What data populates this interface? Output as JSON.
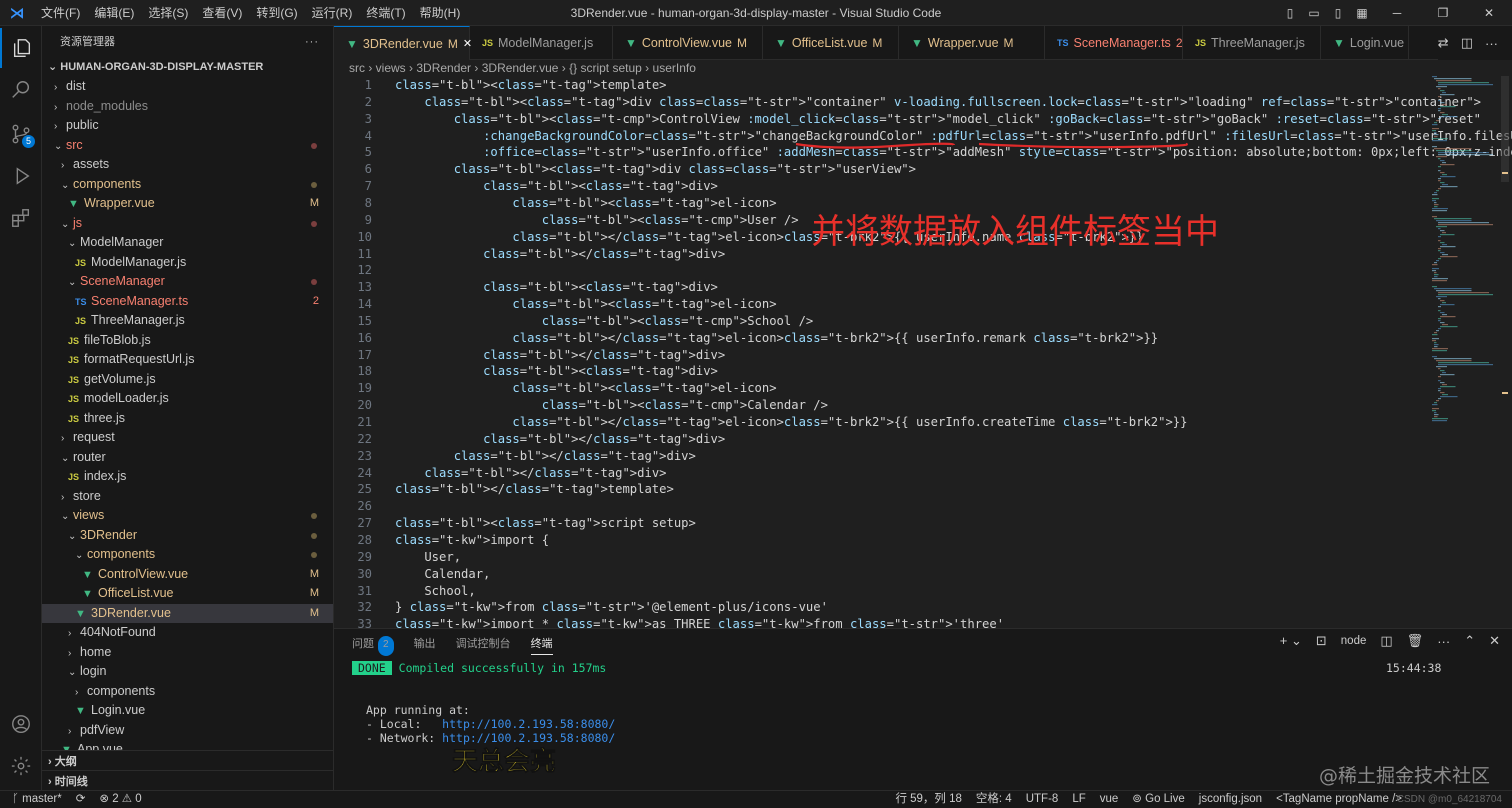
{
  "window": {
    "title": "3DRender.vue - human-organ-3d-display-master - Visual Studio Code",
    "menu": [
      "文件(F)",
      "编辑(E)",
      "选择(S)",
      "查看(V)",
      "转到(G)",
      "运行(R)",
      "终端(T)",
      "帮助(H)"
    ]
  },
  "sidebar": {
    "header": "资源管理器",
    "root": "HUMAN-ORGAN-3D-DISPLAY-MASTER",
    "tree": [
      {
        "label": "dist",
        "depth": 0,
        "folder": true,
        "open": false
      },
      {
        "label": "node_modules",
        "depth": 0,
        "folder": true,
        "open": false,
        "dim": true
      },
      {
        "label": "public",
        "depth": 0,
        "folder": true,
        "open": false
      },
      {
        "label": "src",
        "depth": 0,
        "folder": true,
        "open": true,
        "color": "err",
        "dot": "red"
      },
      {
        "label": "assets",
        "depth": 1,
        "folder": true,
        "open": false
      },
      {
        "label": "components",
        "depth": 1,
        "folder": true,
        "open": true,
        "color": "mod",
        "dot": "mod"
      },
      {
        "label": "Wrapper.vue",
        "depth": 2,
        "type": "vue",
        "color": "mod",
        "mark": "M"
      },
      {
        "label": "js",
        "depth": 1,
        "folder": true,
        "open": true,
        "color": "err",
        "dot": "red"
      },
      {
        "label": "ModelManager",
        "depth": 2,
        "folder": true,
        "open": true
      },
      {
        "label": "ModelManager.js",
        "depth": 3,
        "type": "js"
      },
      {
        "label": "SceneManager",
        "depth": 2,
        "folder": true,
        "open": true,
        "color": "err",
        "dot": "red"
      },
      {
        "label": "SceneManager.ts",
        "depth": 3,
        "type": "ts",
        "color": "err",
        "mark": "2"
      },
      {
        "label": "ThreeManager.js",
        "depth": 3,
        "type": "js"
      },
      {
        "label": "fileToBlob.js",
        "depth": 2,
        "type": "js"
      },
      {
        "label": "formatRequestUrl.js",
        "depth": 2,
        "type": "js"
      },
      {
        "label": "getVolume.js",
        "depth": 2,
        "type": "js"
      },
      {
        "label": "modelLoader.js",
        "depth": 2,
        "type": "js"
      },
      {
        "label": "three.js",
        "depth": 2,
        "type": "js"
      },
      {
        "label": "request",
        "depth": 1,
        "folder": true,
        "open": false
      },
      {
        "label": "router",
        "depth": 1,
        "folder": true,
        "open": true
      },
      {
        "label": "index.js",
        "depth": 2,
        "type": "js"
      },
      {
        "label": "store",
        "depth": 1,
        "folder": true,
        "open": false
      },
      {
        "label": "views",
        "depth": 1,
        "folder": true,
        "open": true,
        "color": "mod",
        "dot": "mod"
      },
      {
        "label": "3DRender",
        "depth": 2,
        "folder": true,
        "open": true,
        "color": "mod",
        "dot": "mod"
      },
      {
        "label": "components",
        "depth": 3,
        "folder": true,
        "open": true,
        "color": "mod",
        "dot": "mod"
      },
      {
        "label": "ControlView.vue",
        "depth": 4,
        "type": "vue",
        "color": "mod",
        "mark": "M"
      },
      {
        "label": "OfficeList.vue",
        "depth": 4,
        "type": "vue",
        "color": "mod",
        "mark": "M"
      },
      {
        "label": "3DRender.vue",
        "depth": 3,
        "type": "vue",
        "color": "mod",
        "mark": "M",
        "selected": true
      },
      {
        "label": "404NotFound",
        "depth": 2,
        "folder": true,
        "open": false
      },
      {
        "label": "home",
        "depth": 2,
        "folder": true,
        "open": false
      },
      {
        "label": "login",
        "depth": 2,
        "folder": true,
        "open": true
      },
      {
        "label": "components",
        "depth": 3,
        "folder": true,
        "open": false
      },
      {
        "label": "Login.vue",
        "depth": 3,
        "type": "vue"
      },
      {
        "label": "pdfView",
        "depth": 2,
        "folder": true,
        "open": false
      },
      {
        "label": "App.vue",
        "depth": 1,
        "type": "vue"
      }
    ],
    "sections": [
      "大纲",
      "时间线"
    ]
  },
  "tabs": [
    {
      "label": "3DRender.vue",
      "status": "M",
      "type": "vue",
      "active": true,
      "closable": true
    },
    {
      "label": "ModelManager.js",
      "status": "",
      "type": "js"
    },
    {
      "label": "ControlView.vue",
      "status": "M",
      "type": "vue"
    },
    {
      "label": "OfficeList.vue",
      "status": "M",
      "type": "vue"
    },
    {
      "label": "Wrapper.vue",
      "status": "M",
      "type": "vue"
    },
    {
      "label": "SceneManager.ts",
      "status": "2",
      "type": "ts"
    },
    {
      "label": "ThreeManager.js",
      "status": "",
      "type": "js"
    },
    {
      "label": "Login.vue",
      "status": "",
      "type": "vue"
    }
  ],
  "breadcrumb": [
    "src",
    "views",
    "3DRender",
    "3DRender.vue",
    "{} script setup",
    "userInfo"
  ],
  "code": [
    "<template>",
    "    <div class=\"container\" v-loading.fullscreen.lock=\"loading\" ref=\"container\">",
    "        <ControlView :model_click=\"model_click\" :goBack=\"goBack\" :reset=\"reset\"",
    "            :changeBackgroundColor=\"changeBackgroundColor\" :pdfUrl=\"userInfo.pdfUrl\" :filesUrl=\"userInfo.filesUrl\"",
    "            :office=\"userInfo.office\" :addMesh=\"addMesh\" style=\"position: absolute;bottom: 0px;left: 0px;z-index: 100;\" />",
    "        <div class=\"userView\">",
    "            <div>",
    "                <el-icon>",
    "                    <User />",
    "                </el-icon>{{ userInfo.name }}",
    "            </div>",
    "",
    "            <div>",
    "                <el-icon>",
    "                    <School />",
    "                </el-icon>{{ userInfo.remark }}",
    "            </div>",
    "            <div>",
    "                <el-icon>",
    "                    <Calendar />",
    "                </el-icon>{{ userInfo.createTime }}",
    "            </div>",
    "        </div>",
    "    </div>",
    "</template>",
    "",
    "<script setup>",
    "import {",
    "    User,",
    "    Calendar,",
    "    School,",
    "} from '@element-plus/icons-vue'",
    "import * as THREE from 'three'"
  ],
  "annotation": "并将数据放入组件标签当中",
  "panel": {
    "tabs": [
      "问题",
      "输出",
      "调试控制台",
      "终端"
    ],
    "problems_count": "2",
    "shell": "node",
    "terminal": {
      "done": "DONE",
      "compiled": "Compiled successfully in 157ms",
      "time": "15:44:38",
      "running": "App running at:",
      "local_label": "- Local:   ",
      "local_url": "http://100.2.193.58:8080/",
      "network_label": "- Network: ",
      "network_url": "http://100.2.193.58:8080/"
    },
    "subtitle": "天总会亮",
    "watermark": "@稀土掘金技术社区"
  },
  "statusbar": {
    "branch": "master*",
    "problems": "⊗ 2 ⚠ 0",
    "position": "行 59，列 18",
    "spaces": "空格: 4",
    "encoding": "UTF-8",
    "eol": "LF",
    "language": "vue",
    "golive": "Go Live",
    "config": "jsconfig.json",
    "tag": "<TagName propName />",
    "overlay": "CSDN @m0_64218704"
  }
}
